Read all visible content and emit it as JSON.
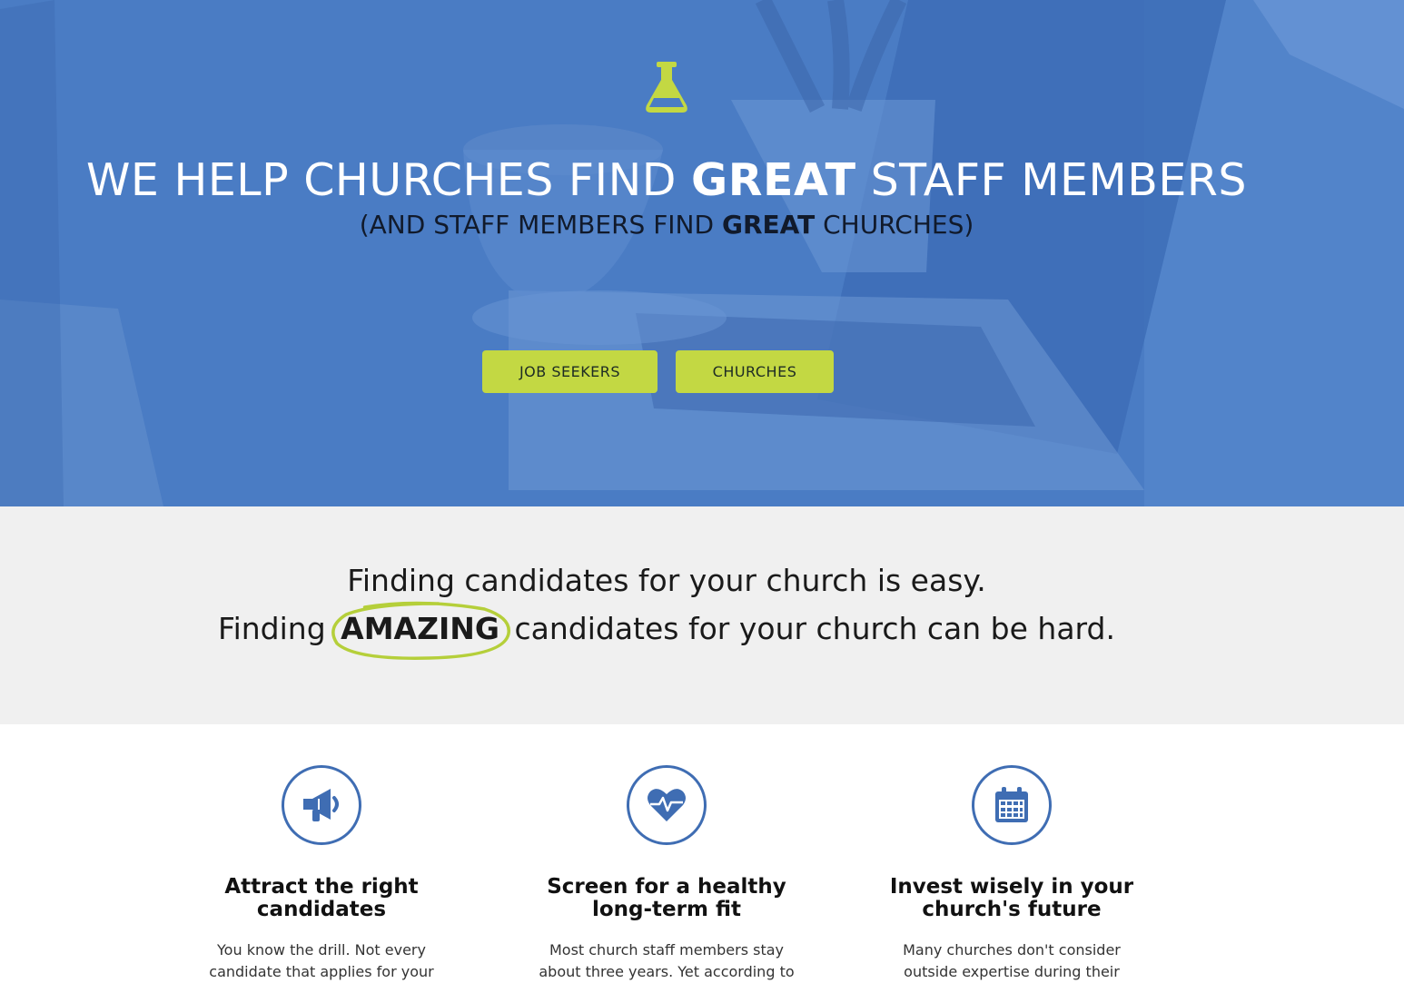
{
  "hero": {
    "icon": "flask-icon",
    "title_pre": "WE HELP CHURCHES FIND ",
    "title_bold": "GREAT",
    "title_post": " STAFF MEMBERS",
    "subtitle_pre": "(AND STAFF MEMBERS FIND ",
    "subtitle_bold": "GREAT",
    "subtitle_post": " CHURCHES)",
    "buttons": {
      "job_seekers": "JOB SEEKERS",
      "churches": "CHURCHES"
    }
  },
  "tagline": {
    "line1": "Finding candidates for your church is easy.",
    "line2_pre": "Finding ",
    "line2_highlight": "AMAZING",
    "line2_post": " candidates for your church can be hard."
  },
  "features": [
    {
      "icon": "megaphone-icon",
      "title_line1": "Attract the right",
      "title_line2": "candidates",
      "body_line1": "You know the drill. Not every",
      "body_line2": "candidate that applies for your"
    },
    {
      "icon": "heartbeat-icon",
      "title_line1": "Screen for a healthy",
      "title_line2": "long-term fit",
      "body_line1": "Most church staff members stay",
      "body_line2": "about three years. Yet according to"
    },
    {
      "icon": "calendar-icon",
      "title_line1": "Invest wisely in your",
      "title_line2": "church's future",
      "body_line1": "Many churches don't consider",
      "body_line2": "outside expertise during their"
    }
  ],
  "colors": {
    "hero_blue": "#4a7cc4",
    "accent_green": "#c3d843",
    "icon_blue": "#3f6db3",
    "band_gray": "#f0f0f0"
  }
}
